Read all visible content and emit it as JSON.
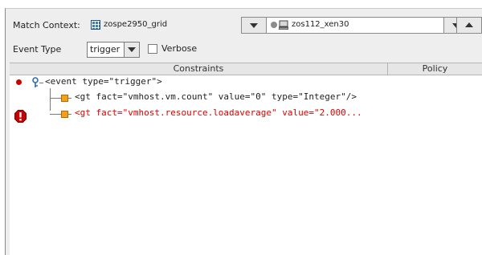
{
  "header": {
    "match_context_label": "Match Context:",
    "grid_name": "zospe2950_grid",
    "grid_icon": "grid-icon",
    "host_combo_value": "zos112_xen30",
    "host_icon": "computer-icon",
    "event_type_label": "Event Type",
    "event_type_value": "trigger",
    "verbose_label": "Verbose",
    "verbose_checked": false
  },
  "table": {
    "columns": [
      "Constraints",
      "Policy"
    ],
    "rows": [
      {
        "text": "<event type=\"trigger\">",
        "status": "ok",
        "color": "#222222"
      },
      {
        "text": "<gt fact=\"vmhost.vm.count\" value=\"0\" type=\"Integer\"/>",
        "status": "ok",
        "color": "#222222"
      },
      {
        "text": "<gt fact=\"vmhost.resource.loadaverage\" value=\"2.000...",
        "status": "error",
        "color": "#e00000"
      }
    ]
  },
  "colors": {
    "error": "#e00000",
    "node_icon": "#f3a01a",
    "grid_icon": "#3a7fc6"
  }
}
